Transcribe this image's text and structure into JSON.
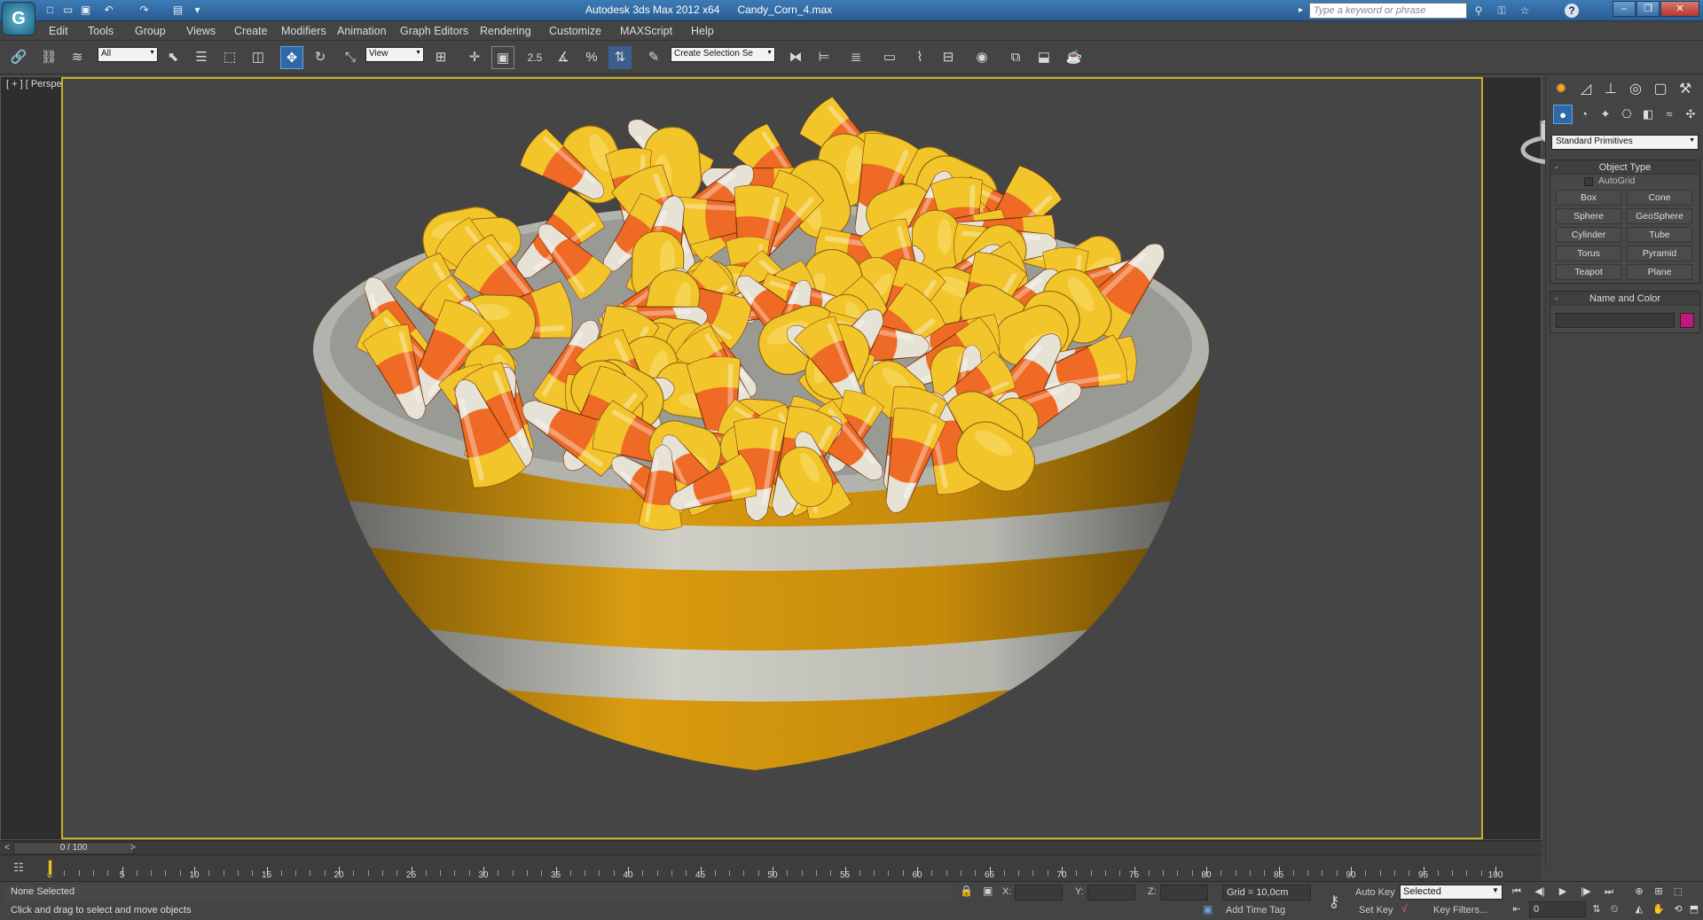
{
  "titlebar": {
    "app_logo": "3ds-max-logo-icon",
    "app_title": "Autodesk 3ds Max  2012 x64",
    "file_name": "Candy_Corn_4.max",
    "search_placeholder": "Type a keyword or phrase",
    "quick_access": [
      "new-icon",
      "open-icon",
      "save-icon",
      "undo-icon",
      "redo-icon",
      "project-folder-icon",
      "customize-arrow-icon"
    ],
    "info_icons": [
      "infocenter-icon",
      "key-icon",
      "favorites-icon",
      "help-icon"
    ],
    "window_buttons": [
      "minimize-icon",
      "restore-icon",
      "close-icon"
    ]
  },
  "menus": [
    "Edit",
    "Tools",
    "Group",
    "Views",
    "Create",
    "Modifiers",
    "Animation",
    "Graph Editors",
    "Rendering",
    "Customize",
    "MAXScript",
    "Help"
  ],
  "toolbar": {
    "selection_filter": "All",
    "ref_coord": "View",
    "snap_angle_label": "2.5",
    "selection_set_placeholder": "Create Selection Se",
    "active_tool": "select-and-move-icon"
  },
  "viewport": {
    "label": "[ + ] [ Perspective ] [ Shaded ]",
    "scene": "candy-corn-bowl",
    "colors": {
      "background": "#454545",
      "active_border": "#c8b11f",
      "bowl_yellow": "#e0a414",
      "bowl_white": "#cfcfc8",
      "candy_orange": "#ee6a25",
      "candy_yellow": "#f2c52b",
      "candy_white": "#e6e2d6"
    }
  },
  "command_panel": {
    "dropdown": "Standard Primitives",
    "object_type": {
      "title": "Object Type",
      "autogrid_label": "AutoGrid",
      "buttons": [
        "Box",
        "Cone",
        "Sphere",
        "GeoSphere",
        "Cylinder",
        "Tube",
        "Torus",
        "Pyramid",
        "Teapot",
        "Plane"
      ]
    },
    "name_color": {
      "title": "Name and Color",
      "swatch_color": "#c2187a"
    }
  },
  "timeline": {
    "frame_display": "0 / 100",
    "tick_labels": [
      "0",
      "5",
      "10",
      "15",
      "20",
      "25",
      "30",
      "35",
      "40",
      "45",
      "50",
      "55",
      "60",
      "65",
      "70",
      "75",
      "80",
      "85",
      "90",
      "95",
      "100"
    ]
  },
  "status": {
    "selection_info": "None Selected",
    "prompt": "Click and drag to select and move objects",
    "x_label": "X:",
    "y_label": "Y:",
    "z_label": "Z:",
    "grid": "Grid = 10,0cm",
    "add_time_tag": "Add Time Tag",
    "auto_key": "Auto Key",
    "set_key": "Set Key",
    "key_mode": "Selected",
    "key_filters": "Key Filters...",
    "current_frame": "0"
  }
}
